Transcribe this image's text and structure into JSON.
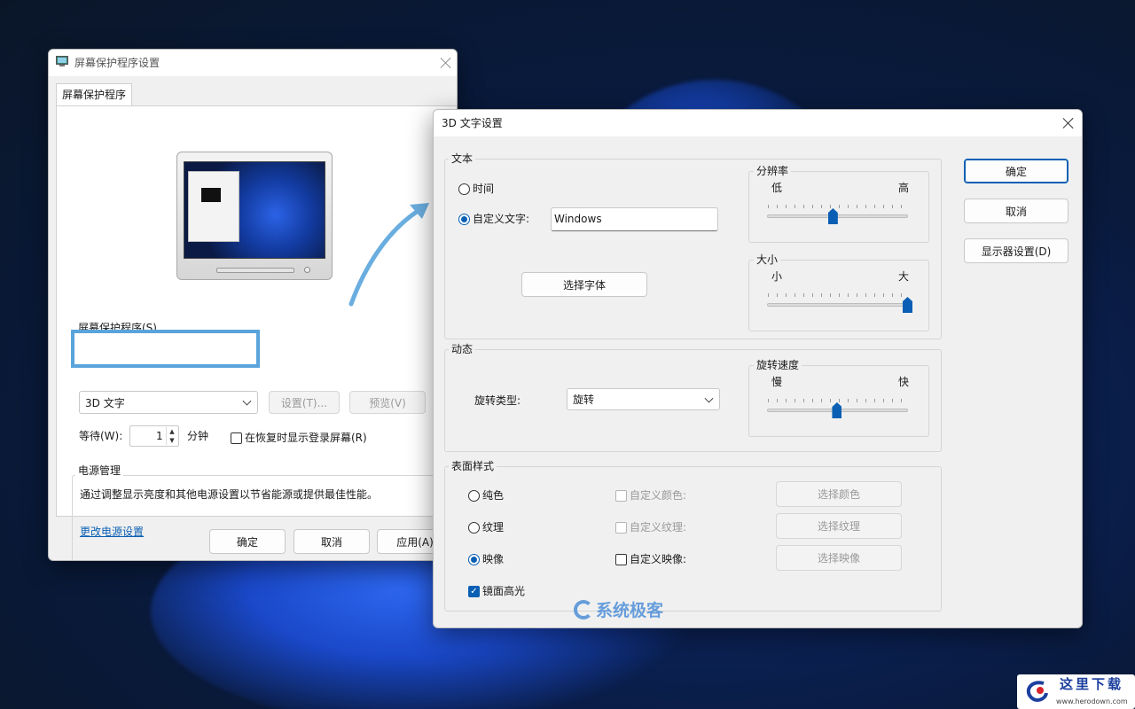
{
  "screensaver_dialog": {
    "title": "屏幕保护程序设置",
    "tab": "屏幕保护程序",
    "screensaver_group_label": "屏幕保护程序(S)",
    "selected_screensaver": "3D 文字",
    "settings_button": "设置(T)...",
    "preview_button": "预览(V)",
    "wait_label": "等待(W):",
    "wait_value": "1",
    "minutes_label": "分钟",
    "resume_checkbox_label": "在恢复时显示登录屏幕(R)",
    "resume_checked": false,
    "power_group_label": "电源管理",
    "power_description": "通过调整显示亮度和其他电源设置以节省能源或提供最佳性能。",
    "power_link": "更改电源设置",
    "ok_button": "确定",
    "cancel_button": "取消",
    "apply_button": "应用(A)"
  },
  "text3d_dialog": {
    "title": "3D 文字设置",
    "text_group_label": "文本",
    "time_option": "时间",
    "time_selected": false,
    "custom_text_option": "自定义文字:",
    "custom_text_selected": true,
    "custom_text_value": "Windows",
    "choose_font_button": "选择字体",
    "resolution": {
      "label": "分辨率",
      "low": "低",
      "high": "高",
      "level": 0.45
    },
    "size": {
      "label": "大小",
      "small": "小",
      "large": "大",
      "level": 1.0
    },
    "motion_group_label": "动态",
    "rotation_type_label": "旋转类型:",
    "rotation_type_value": "旋转",
    "rotation_speed": {
      "label": "旋转速度",
      "slow": "慢",
      "fast": "快",
      "level": 0.48
    },
    "surface_group_label": "表面样式",
    "solid_color": "纯色",
    "texture": "纹理",
    "reflection": "映像",
    "surface_selected": "映像",
    "custom_color": "自定义颜色:",
    "custom_texture": "自定义纹理:",
    "custom_reflection": "自定义映像:",
    "choose_color_button": "选择颜色",
    "choose_texture_button": "选择纹理",
    "choose_reflection_button": "选择映像",
    "specular_highlight": "镜面高光",
    "specular_checked": true,
    "ok_button": "确定",
    "cancel_button": "取消",
    "display_settings_button": "显示器设置(D)"
  },
  "watermark_text": "系统极客",
  "corner_logo_text": "这里下载",
  "corner_logo_url": "www.herodown.com",
  "colors": {
    "accent": "#0a5fb4",
    "highlight_frame": "#5aa4dc",
    "arrow": "#6aaee0"
  }
}
